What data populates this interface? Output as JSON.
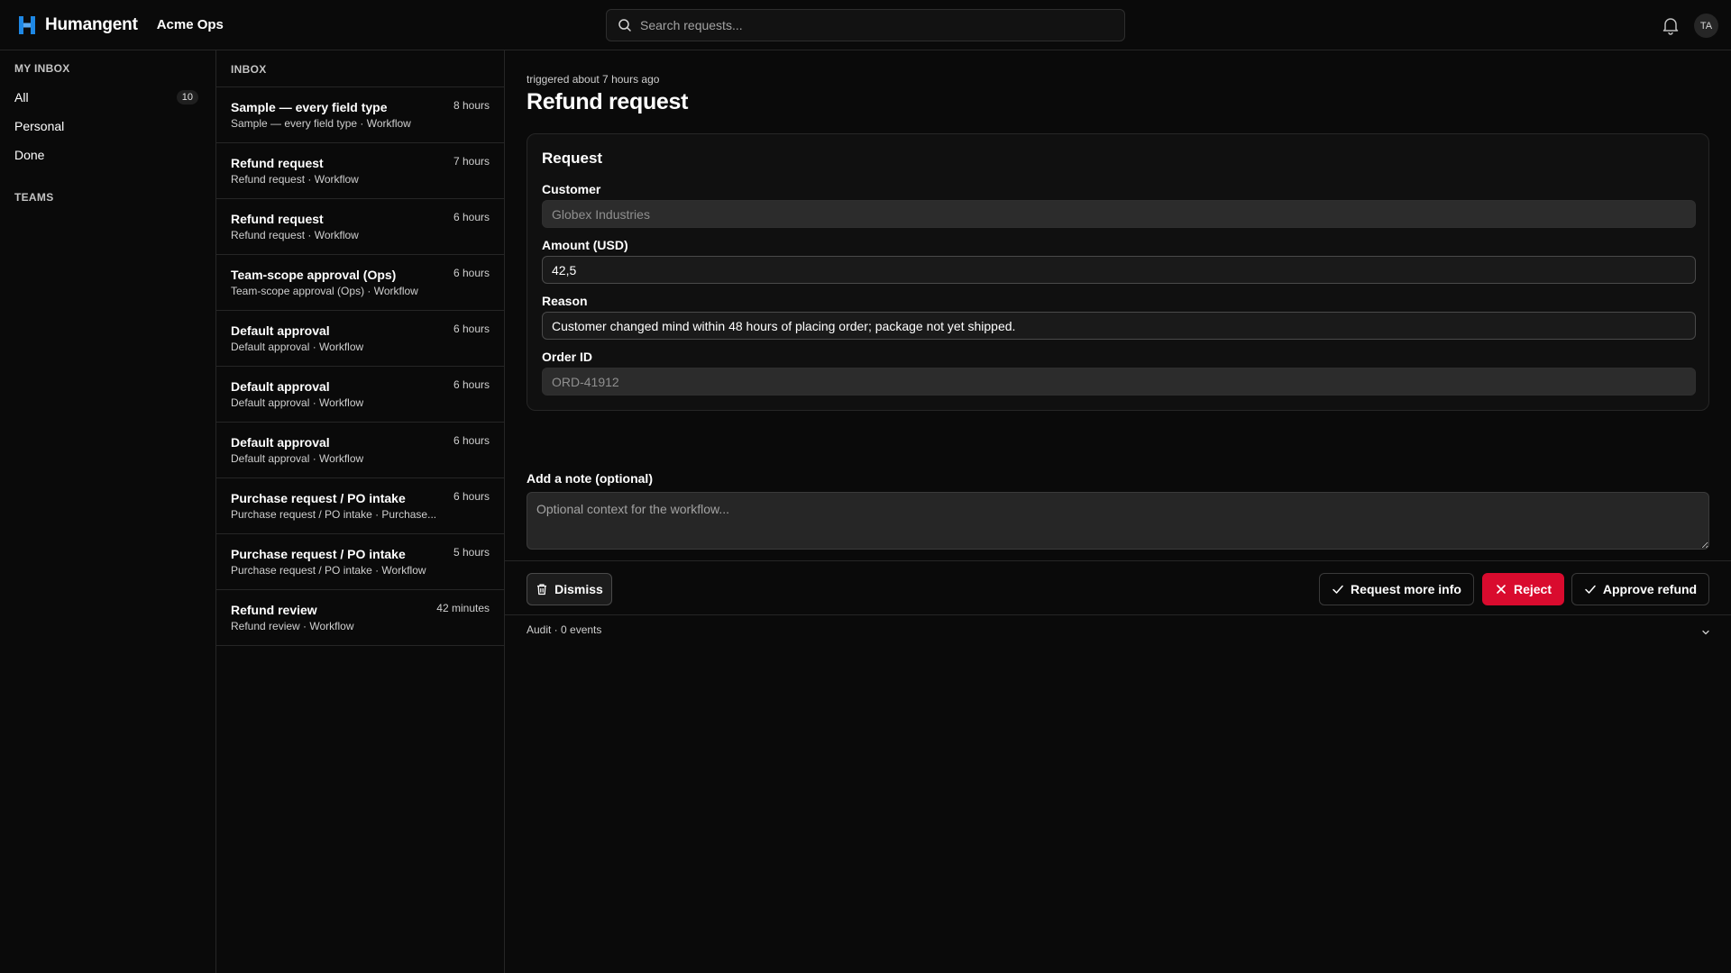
{
  "app": {
    "name": "Humangent",
    "org": "Acme Ops",
    "brand_color": "#1e88e5",
    "user_initials": "TA"
  },
  "search": {
    "placeholder": "Search requests..."
  },
  "sidebar": {
    "my_inbox_label": "MY INBOX",
    "items": [
      {
        "label": "All",
        "count": "10"
      },
      {
        "label": "Personal"
      },
      {
        "label": "Done"
      }
    ],
    "teams_label": "TEAMS"
  },
  "inbox": {
    "header": "INBOX",
    "items": [
      {
        "title": "Sample — every field type",
        "subtitle": "Sample — every field type · Workflow",
        "time": "8 hours"
      },
      {
        "title": "Refund request",
        "subtitle": "Refund request · Workflow",
        "time": "7 hours"
      },
      {
        "title": "Refund request",
        "subtitle": "Refund request · Workflow",
        "time": "6 hours"
      },
      {
        "title": "Team-scope approval (Ops)",
        "subtitle": "Team-scope approval (Ops) · Workflow",
        "time": "6 hours"
      },
      {
        "title": "Default approval",
        "subtitle": "Default approval · Workflow",
        "time": "6 hours"
      },
      {
        "title": "Default approval",
        "subtitle": "Default approval · Workflow",
        "time": "6 hours"
      },
      {
        "title": "Default approval",
        "subtitle": "Default approval · Workflow",
        "time": "6 hours"
      },
      {
        "title": "Purchase request / PO intake",
        "subtitle": "Purchase request / PO intake · Purchase...",
        "time": "6 hours"
      },
      {
        "title": "Purchase request / PO intake",
        "subtitle": "Purchase request / PO intake · Workflow",
        "time": "5 hours"
      },
      {
        "title": "Refund review",
        "subtitle": "Refund review · Workflow",
        "time": "42 minutes"
      }
    ]
  },
  "detail": {
    "triggered": "triggered about 7 hours ago",
    "title": "Refund request",
    "card_title": "Request",
    "fields": [
      {
        "label": "Customer",
        "value": "Globex Industries"
      },
      {
        "label": "Amount (USD)",
        "value": "42,5"
      },
      {
        "label": "Reason",
        "value": "Customer changed mind within 48 hours of placing order; package not yet shipped."
      },
      {
        "label": "Order ID",
        "value": "ORD-41912"
      }
    ],
    "note_label": "Add a note (optional)",
    "note_placeholder": "Optional context for the workflow...",
    "actions": {
      "dismiss": "Dismiss",
      "request_more": "Request more info",
      "reject": "Reject",
      "approve": "Approve refund",
      "reject_color": "#d90b2e"
    },
    "audit": "Audit · 0 events"
  }
}
